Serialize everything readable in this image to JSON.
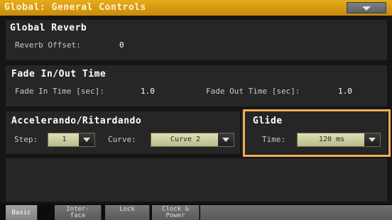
{
  "header": {
    "title": "Global: General Controls"
  },
  "global_reverb": {
    "title": "Global Reverb",
    "offset_label": "Reverb Offset:",
    "offset_value": "0"
  },
  "fade": {
    "title": "Fade In/Out Time",
    "in_label": "Fade In Time [sec]:",
    "in_value": "1.0",
    "out_label": "Fade Out Time [sec]:",
    "out_value": "1.0"
  },
  "accel": {
    "title": "Accelerando/Ritardando",
    "step_label": "Step:",
    "step_value": "1",
    "curve_label": "Curve:",
    "curve_value": "Curve 2"
  },
  "glide": {
    "title": "Glide",
    "time_label": "Time:",
    "time_value": "120 ms",
    "highlight_color": "#f0ad52"
  },
  "tabs": [
    {
      "label": "Basic",
      "active": true
    },
    {
      "label": "Inter-\nface",
      "active": false
    },
    {
      "label": "Lock",
      "active": false
    },
    {
      "label": "Clock &\nPower",
      "active": false
    }
  ],
  "colors": {
    "title_bar": "#d89c12",
    "panel_bg": "#262626",
    "background": "#151515"
  },
  "icons": {
    "menu": "triangle-down-icon",
    "dropdown": "triangle-down-icon"
  }
}
